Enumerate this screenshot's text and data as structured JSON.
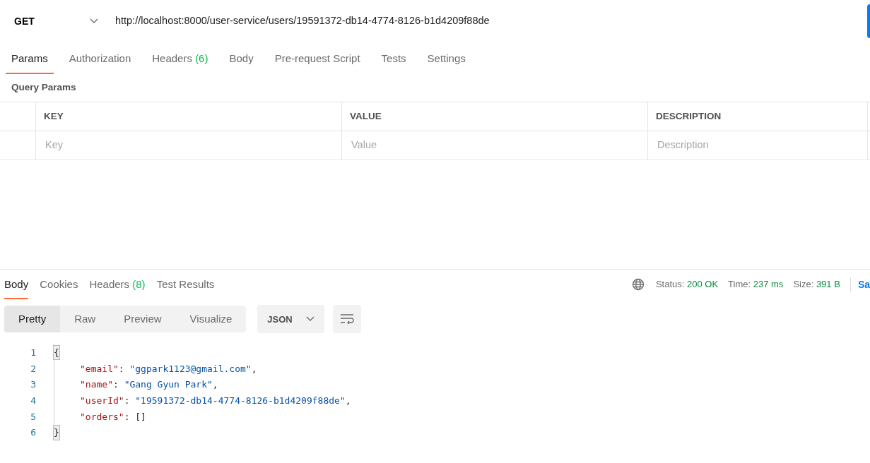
{
  "request": {
    "method": "GET",
    "url": "http://localhost:8000/user-service/users/19591372-db14-4774-8126-b1d4209f88de"
  },
  "request_tabs": [
    {
      "label": "Params",
      "selected": true
    },
    {
      "label": "Authorization",
      "selected": false
    },
    {
      "label": "Headers",
      "count": "(6)",
      "selected": false
    },
    {
      "label": "Body",
      "selected": false
    },
    {
      "label": "Pre-request Script",
      "selected": false
    },
    {
      "label": "Tests",
      "selected": false
    },
    {
      "label": "Settings",
      "selected": false
    }
  ],
  "query_params": {
    "title": "Query Params",
    "columns": [
      "KEY",
      "VALUE",
      "DESCRIPTION"
    ],
    "placeholders": [
      "Key",
      "Value",
      "Description"
    ]
  },
  "response_tabs": [
    {
      "label": "Body",
      "selected": true
    },
    {
      "label": "Cookies",
      "selected": false
    },
    {
      "label": "Headers",
      "count": "(8)",
      "selected": false
    },
    {
      "label": "Test Results",
      "selected": false
    }
  ],
  "status": [
    {
      "label": "Status:",
      "value": "200 OK"
    },
    {
      "label": "Time:",
      "value": "237 ms"
    },
    {
      "label": "Size:",
      "value": "391 B"
    }
  ],
  "save_button": "Sa",
  "view_modes": [
    {
      "label": "Pretty",
      "selected": true
    },
    {
      "label": "Raw",
      "selected": false
    },
    {
      "label": "Preview",
      "selected": false
    },
    {
      "label": "Visualize",
      "selected": false
    }
  ],
  "format": "JSON",
  "code_lines": [
    {
      "number": "1",
      "indented": false,
      "tokens": [
        {
          "kind": "brace",
          "text": "{"
        }
      ]
    },
    {
      "number": "2",
      "indented": true,
      "tokens": [
        {
          "kind": "key",
          "text": "\"email\""
        },
        {
          "kind": "punct",
          "text": ": "
        },
        {
          "kind": "string",
          "text": "\"ggpark1123@gmail.com\""
        },
        {
          "kind": "punct",
          "text": ","
        }
      ]
    },
    {
      "number": "3",
      "indented": true,
      "tokens": [
        {
          "kind": "key",
          "text": "\"name\""
        },
        {
          "kind": "punct",
          "text": ": "
        },
        {
          "kind": "string",
          "text": "\"Gang Gyun Park\""
        },
        {
          "kind": "punct",
          "text": ","
        }
      ]
    },
    {
      "number": "4",
      "indented": true,
      "tokens": [
        {
          "kind": "key",
          "text": "\"userId\""
        },
        {
          "kind": "punct",
          "text": ": "
        },
        {
          "kind": "string",
          "text": "\"19591372-db14-4774-8126-b1d4209f88de\""
        },
        {
          "kind": "punct",
          "text": ","
        }
      ]
    },
    {
      "number": "5",
      "indented": true,
      "tokens": [
        {
          "kind": "key",
          "text": "\"orders\""
        },
        {
          "kind": "punct",
          "text": ": "
        },
        {
          "kind": "array",
          "text": "[]"
        }
      ]
    },
    {
      "number": "6",
      "indented": false,
      "tokens": [
        {
          "kind": "brace",
          "text": "}"
        }
      ]
    }
  ]
}
